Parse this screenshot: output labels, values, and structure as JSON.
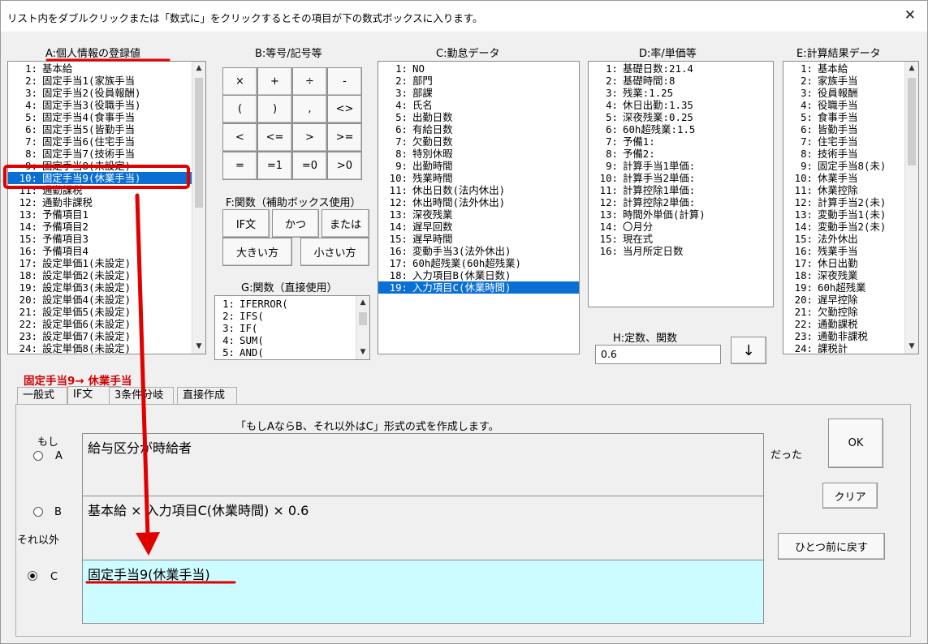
{
  "window": {
    "title": "リスト内をダブルクリックまたは「数式に」をクリックするとその項目が下の数式ボックスに入ります。"
  },
  "headers": {
    "a": "A:個人情報の登録値",
    "b": "B:等号/記号等",
    "c": "C:勤怠データ",
    "d": "D:率/単価等",
    "e": "E:計算結果データ",
    "f": "F:関数（補助ボックス使用）",
    "g": "G:関数（直接使用）",
    "h": "H:定数、関数"
  },
  "list_a": [
    {
      "n": "1:",
      "t": "基本給"
    },
    {
      "n": "2:",
      "t": "固定手当1(家族手当"
    },
    {
      "n": "3:",
      "t": "固定手当2(役員報酬)"
    },
    {
      "n": "4:",
      "t": "固定手当3(役職手当)"
    },
    {
      "n": "5:",
      "t": "固定手当4(食事手当"
    },
    {
      "n": "6:",
      "t": "固定手当5(皆勤手当"
    },
    {
      "n": "7:",
      "t": "固定手当6(住宅手当"
    },
    {
      "n": "8:",
      "t": "固定手当7(技術手当"
    },
    {
      "n": "9:",
      "t": "固定手当8(未設定)"
    },
    {
      "n": "10:",
      "t": "固定手当9(休業手当)",
      "selected": true
    },
    {
      "n": "11:",
      "t": "通勤課税"
    },
    {
      "n": "12:",
      "t": "通勤非課税"
    },
    {
      "n": "13:",
      "t": "予備項目1"
    },
    {
      "n": "14:",
      "t": "予備項目2"
    },
    {
      "n": "15:",
      "t": "予備項目3"
    },
    {
      "n": "16:",
      "t": "予備項目4"
    },
    {
      "n": "17:",
      "t": "設定単価1(未設定)"
    },
    {
      "n": "18:",
      "t": "設定単価2(未設定)"
    },
    {
      "n": "19:",
      "t": "設定単価3(未設定)"
    },
    {
      "n": "20:",
      "t": "設定単価4(未設定)"
    },
    {
      "n": "21:",
      "t": "設定単価5(未設定)"
    },
    {
      "n": "22:",
      "t": "設定単価6(未設定)"
    },
    {
      "n": "23:",
      "t": "設定単価7(未設定)"
    },
    {
      "n": "24:",
      "t": "設定単価8(未設定)"
    }
  ],
  "symbols": [
    [
      "×",
      "+",
      "÷",
      "-"
    ],
    [
      "(",
      ")",
      ",",
      "<>"
    ],
    [
      "<",
      "<=",
      ">",
      ">="
    ],
    [
      "=",
      "=1",
      "=0",
      ">0"
    ]
  ],
  "func_buttons": {
    "if": "IF文",
    "and": "かつ",
    "or": "または",
    "max": "大きい方",
    "min": "小さい方"
  },
  "list_g": [
    {
      "n": "1:",
      "t": "IFERROR("
    },
    {
      "n": "2:",
      "t": "IFS("
    },
    {
      "n": "3:",
      "t": "IF("
    },
    {
      "n": "4:",
      "t": "SUM("
    },
    {
      "n": "5:",
      "t": "AND("
    }
  ],
  "list_c": [
    {
      "n": "1:",
      "t": "NO"
    },
    {
      "n": "2:",
      "t": "部門"
    },
    {
      "n": "3:",
      "t": "部課"
    },
    {
      "n": "4:",
      "t": "氏名"
    },
    {
      "n": "5:",
      "t": "出勤日数"
    },
    {
      "n": "6:",
      "t": "有給日数"
    },
    {
      "n": "7:",
      "t": "欠勤日数"
    },
    {
      "n": "8:",
      "t": "特別休暇"
    },
    {
      "n": "9:",
      "t": "出勤時間"
    },
    {
      "n": "10:",
      "t": "残業時間"
    },
    {
      "n": "11:",
      "t": "休出日数(法内休出)"
    },
    {
      "n": "12:",
      "t": "休出時間(法外休出)"
    },
    {
      "n": "13:",
      "t": "深夜残業"
    },
    {
      "n": "14:",
      "t": "遅早回数"
    },
    {
      "n": "15:",
      "t": "遅早時間"
    },
    {
      "n": "16:",
      "t": "変動手当3(法外休出)"
    },
    {
      "n": "17:",
      "t": "60h超残業(60h超残業)"
    },
    {
      "n": "18:",
      "t": "入力項目B(休業日数)"
    },
    {
      "n": "19:",
      "t": "入力項目C(休業時間)",
      "selected": true
    }
  ],
  "list_d": [
    {
      "n": "1:",
      "t": "基礎日数:21.4"
    },
    {
      "n": "2:",
      "t": "基礎時間:8"
    },
    {
      "n": "3:",
      "t": "残業:1.25"
    },
    {
      "n": "4:",
      "t": "休日出勤:1.35"
    },
    {
      "n": "5:",
      "t": "深夜残業:0.25"
    },
    {
      "n": "6:",
      "t": "60h超残業:1.5"
    },
    {
      "n": "7:",
      "t": "予備1:"
    },
    {
      "n": "8:",
      "t": "予備2:"
    },
    {
      "n": "9:",
      "t": "計算手当1単価:"
    },
    {
      "n": "10:",
      "t": "計算手当2単価:"
    },
    {
      "n": "11:",
      "t": "計算控除1単価:"
    },
    {
      "n": "12:",
      "t": "計算控除2単価:"
    },
    {
      "n": "13:",
      "t": "時間外単価(計算)"
    },
    {
      "n": "14:",
      "t": "〇月分"
    },
    {
      "n": "15:",
      "t": "現在式"
    },
    {
      "n": "16:",
      "t": "当月所定日数"
    }
  ],
  "list_e": [
    {
      "n": "1:",
      "t": "基本給"
    },
    {
      "n": "2:",
      "t": "家族手当"
    },
    {
      "n": "3:",
      "t": "役員報酬"
    },
    {
      "n": "4:",
      "t": "役職手当"
    },
    {
      "n": "5:",
      "t": "食事手当"
    },
    {
      "n": "6:",
      "t": "皆勤手当"
    },
    {
      "n": "7:",
      "t": "住宅手当"
    },
    {
      "n": "8:",
      "t": "技術手当"
    },
    {
      "n": "9:",
      "t": "固定手当8(未)"
    },
    {
      "n": "10:",
      "t": "休業手当"
    },
    {
      "n": "11:",
      "t": "休業控除"
    },
    {
      "n": "12:",
      "t": "計算手当2(未)"
    },
    {
      "n": "13:",
      "t": "変動手当1(未)"
    },
    {
      "n": "14:",
      "t": "変動手当2(未)"
    },
    {
      "n": "15:",
      "t": "法外休出"
    },
    {
      "n": "16:",
      "t": "残業手当"
    },
    {
      "n": "17:",
      "t": "休日出勤"
    },
    {
      "n": "18:",
      "t": "深夜残業"
    },
    {
      "n": "19:",
      "t": "60h超残業"
    },
    {
      "n": "20:",
      "t": "遅早控除"
    },
    {
      "n": "21:",
      "t": "欠勤控除"
    },
    {
      "n": "22:",
      "t": "通勤課税"
    },
    {
      "n": "23:",
      "t": "通勤非課税"
    },
    {
      "n": "24:",
      "t": "課税計"
    }
  ],
  "h_input": "0.6",
  "down_arrow": "↓",
  "annotation": "固定手当9→ 休業手当",
  "tabs": [
    "一般式",
    "IF文",
    "3条件分岐",
    "直接作成"
  ],
  "if_panel": {
    "description": "「もしAならB、それ以外はC」形式の式を作成します。",
    "moshi": "もし",
    "a_label": "A",
    "b_label": "B",
    "c_label": "C",
    "soreigai": "それ以外",
    "datta": "だった",
    "field_a": "給与区分が時給者",
    "field_b": "基本給 × 入力項目C(休業時間) × 0.6",
    "field_c": "固定手当9(休業手当)",
    "ok": "OK",
    "clear": "クリア",
    "undo": "ひとつ前に戻す"
  }
}
